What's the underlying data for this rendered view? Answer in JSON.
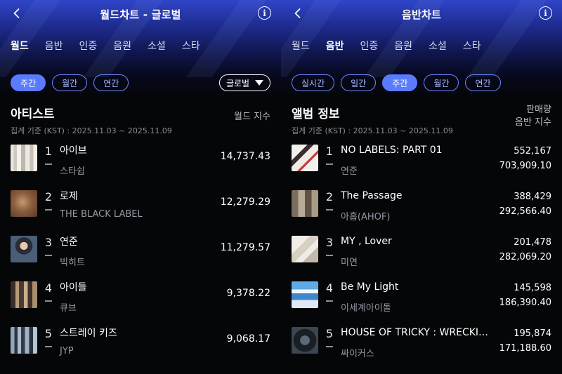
{
  "left": {
    "title": "월드차트 - 글로벌",
    "tabs": [
      "월드",
      "음반",
      "인증",
      "음원",
      "소셜",
      "스타"
    ],
    "active_tab": 0,
    "periods": [
      "주간",
      "월간",
      "연간"
    ],
    "active_period": 0,
    "region_dropdown": "글로벌",
    "section_title": "아티스트",
    "date_range": "집계 기준 (KST) : 2025.11.03 ~ 2025.11.09",
    "metric_label": "월드 지수",
    "rows": [
      {
        "rank": "1",
        "name": "아이브",
        "agency": "스타쉽",
        "score": "14,737.43"
      },
      {
        "rank": "2",
        "name": "로제",
        "agency": "THE BLACK LABEL",
        "score": "12,279.29"
      },
      {
        "rank": "3",
        "name": "연준",
        "agency": "빅히트",
        "score": "11,279.57"
      },
      {
        "rank": "4",
        "name": "아이들",
        "agency": "큐브",
        "score": "9,378.22"
      },
      {
        "rank": "5",
        "name": "스트레이 키즈",
        "agency": "JYP",
        "score": "9,068.17"
      }
    ]
  },
  "right": {
    "title": "음반차트",
    "tabs": [
      "월드",
      "음반",
      "인증",
      "음원",
      "소셜",
      "스타"
    ],
    "active_tab": 1,
    "periods": [
      "실시간",
      "일간",
      "주간",
      "월간",
      "연간"
    ],
    "active_period": 2,
    "section_title": "앨범 정보",
    "date_range": "집계 기준 (KST) : 2025.11.03 ~ 2025.11.09",
    "metric_label_1": "판매량",
    "metric_label_2": "음반 지수",
    "rows": [
      {
        "rank": "1",
        "album": "NO LABELS: PART 01",
        "artist": "연준",
        "sales": "552,167",
        "index": "703,909.10"
      },
      {
        "rank": "2",
        "album": "The Passage",
        "artist": "아홉(AHOF)",
        "sales": "388,429",
        "index": "292,566.40"
      },
      {
        "rank": "3",
        "album": "MY , Lover",
        "artist": "미연",
        "sales": "201,478",
        "index": "282,069.20"
      },
      {
        "rank": "4",
        "album": "Be My Light",
        "artist": "이세계아이돌",
        "sales": "145,598",
        "index": "186,390.40"
      },
      {
        "rank": "5",
        "album": "HOUSE OF TRICKY : WRECKING THE HOUSE",
        "artist": "싸이커스",
        "sales": "195,874",
        "index": "171,188.60"
      }
    ]
  },
  "colors": {
    "accent": "#5b7bff",
    "pill_border": "#6f86ff",
    "header_gradient_top": "#2f45c8",
    "background": "#050608"
  },
  "icons": {
    "back": "chevron-left-icon",
    "info": "info-icon",
    "dropdown": "caret-down-icon"
  }
}
